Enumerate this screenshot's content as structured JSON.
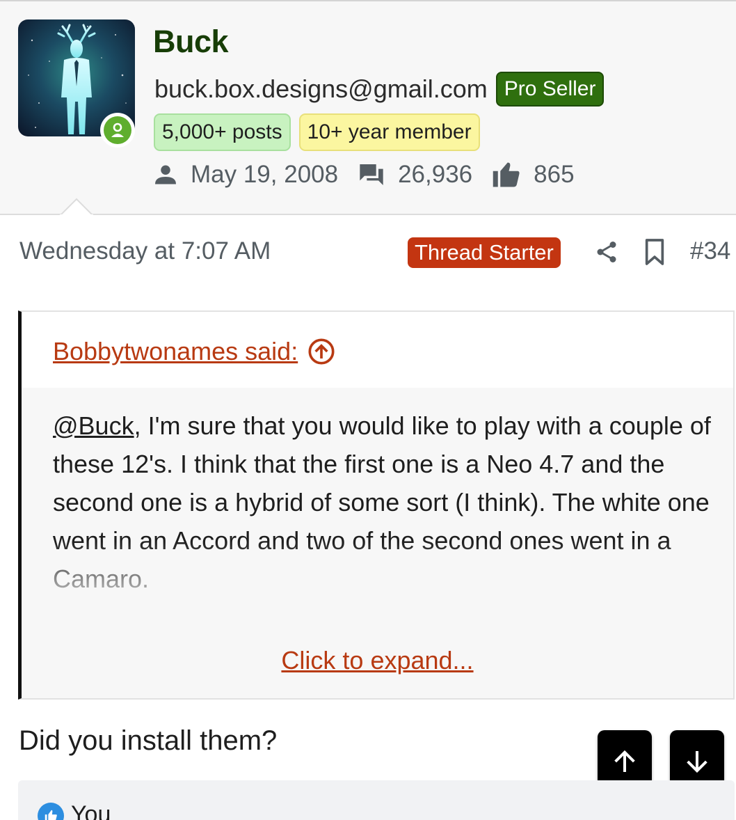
{
  "profile": {
    "username": "Buck",
    "email": "buck.box.designs@gmail.com",
    "pro_badge": "Pro Seller",
    "badges": [
      "5,000+ posts",
      "10+ year member"
    ],
    "joined": "May 19, 2008",
    "messages": "26,936",
    "reactions": "865"
  },
  "post": {
    "date": "Wednesday at 7:07 AM",
    "thread_starter": "Thread Starter",
    "number": "#34",
    "quote": {
      "author": "Bobbytwonames said:",
      "mention": "@Buck",
      "text": ", I'm sure that you would like to play with a couple of these 12's. I think that the first one is a Neo 4.7 and the second one is a hybrid of some sort (I think). The white one went in an Accord and two of the second ones went in a Camaro.",
      "expand": "Click to expand..."
    },
    "reply": "Did you install them?",
    "reaction_user": "You"
  },
  "colors": {
    "accent": "#c33511",
    "link": "#b83a12",
    "pro_seller": "#2f6f0e",
    "posts_badge": "#c8f2c0",
    "member_badge": "#fbf6a0",
    "online": "#5fae2e"
  },
  "icons": [
    "user-icon",
    "messages-icon",
    "thumbs-up-icon",
    "share-icon",
    "bookmark-icon",
    "arrow-up-circle-icon",
    "arrow-up-icon",
    "arrow-down-icon",
    "like-icon"
  ]
}
